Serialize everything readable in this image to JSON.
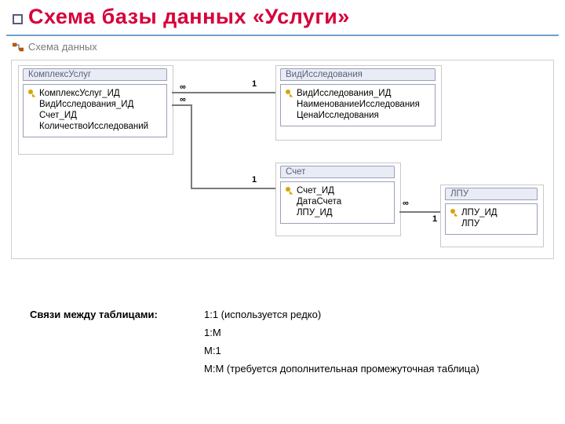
{
  "page": {
    "title": "Схема базы данных «Услуги»",
    "window_tab": "Схема данных"
  },
  "entities": {
    "komplex": {
      "title": "КомплексУслуг",
      "fields": [
        {
          "name": "КомплексУслуг_ИД",
          "pk": true
        },
        {
          "name": "ВидИсследования_ИД",
          "pk": false
        },
        {
          "name": "Счет_ИД",
          "pk": false
        },
        {
          "name": "КоличествоИсследований",
          "pk": false
        }
      ]
    },
    "vid": {
      "title": "ВидИсследования",
      "fields": [
        {
          "name": "ВидИсследования_ИД",
          "pk": true
        },
        {
          "name": "НаименованиеИсследования",
          "pk": false
        },
        {
          "name": "ЦенаИсследования",
          "pk": false
        }
      ]
    },
    "schet": {
      "title": "Счет",
      "fields": [
        {
          "name": "Счет_ИД",
          "pk": true
        },
        {
          "name": "ДатаСчета",
          "pk": false
        },
        {
          "name": "ЛПУ_ИД",
          "pk": false
        }
      ]
    },
    "lpu": {
      "title": "ЛПУ",
      "fields": [
        {
          "name": "ЛПУ_ИД",
          "pk": true
        },
        {
          "name": "ЛПУ",
          "pk": false
        }
      ]
    }
  },
  "rel_labels": {
    "one_a": "1",
    "inf_a": "∞",
    "one_b": "1",
    "inf_b": "∞",
    "inf_c": "∞",
    "one_c": "1"
  },
  "legend": {
    "label": "Связи между таблицами:",
    "rows": [
      "1:1 (используется редко)",
      "1:М",
      "М:1",
      "М:М (требуется дополнительная промежуточная таблица)"
    ]
  }
}
